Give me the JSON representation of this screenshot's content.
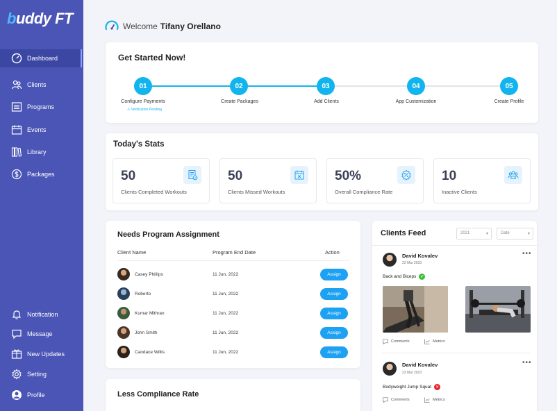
{
  "brand": {
    "logo_first": "b",
    "logo_rest": "uddy FT"
  },
  "nav": {
    "top": [
      {
        "label": "Dashboard",
        "icon": "dashboard-icon"
      },
      {
        "label": "Clients",
        "icon": "clients-icon"
      },
      {
        "label": "Programs",
        "icon": "programs-icon"
      },
      {
        "label": "Events",
        "icon": "events-icon"
      },
      {
        "label": "Library",
        "icon": "library-icon"
      },
      {
        "label": "Packages",
        "icon": "packages-icon"
      }
    ],
    "bottom": [
      {
        "label": "Notification",
        "icon": "bell-icon"
      },
      {
        "label": "Message",
        "icon": "message-icon"
      },
      {
        "label": "New Updates",
        "icon": "updates-icon"
      },
      {
        "label": "Setting",
        "icon": "gear-icon"
      },
      {
        "label": "Profile",
        "icon": "profile-icon"
      }
    ]
  },
  "header": {
    "welcome": "Welcome",
    "user_name": "Tifany Orellano"
  },
  "get_started": {
    "title": "Get Started Now!",
    "steps": [
      {
        "num": "01",
        "label": "Configure Payments",
        "sub": "Verification Pending"
      },
      {
        "num": "02",
        "label": "Create Packages"
      },
      {
        "num": "03",
        "label": "Add Clients"
      },
      {
        "num": "04",
        "label": "App Customization"
      },
      {
        "num": "05",
        "label": "Create Profile"
      }
    ]
  },
  "stats": {
    "title": "Today's Stats",
    "items": [
      {
        "value": "50",
        "label": "Clients Completed Workouts",
        "icon": "workout-check-icon"
      },
      {
        "value": "50",
        "label": "Clients Missed Workouts",
        "icon": "calendar-x-icon"
      },
      {
        "value": "50%",
        "label": "Overall Compliance Rate",
        "icon": "compliance-badge-icon"
      },
      {
        "value": "10",
        "label": "Inactive Clients",
        "icon": "group-icon"
      }
    ]
  },
  "program_assignment": {
    "title": "Needs Program Assignment",
    "columns": [
      "Client Name",
      "Program End Date",
      "Action"
    ],
    "rows": [
      {
        "name": "Casey Phillips",
        "date": "11 Jun, 2022",
        "action": "Assign"
      },
      {
        "name": "Roberto",
        "date": "11 Jun, 2022",
        "action": "Assign"
      },
      {
        "name": "Kumar Mithran",
        "date": "11 Jun, 2022",
        "action": "Assign"
      },
      {
        "name": "John Smith",
        "date": "11 Jun, 2022",
        "action": "Assign"
      },
      {
        "name": "Candace Willis",
        "date": "11 Jun, 2022",
        "action": "Assign"
      }
    ]
  },
  "less_compliance": {
    "title": "Less Compliance Rate"
  },
  "feed": {
    "title": "Clients Feed",
    "year_select": "2021",
    "date_select": "Date",
    "posts": [
      {
        "name": "David Kovalev",
        "date": "23 Mar 2023",
        "title": "Back and Biceps",
        "status": "completed",
        "comments": "Comments",
        "metrics": "Metrics"
      },
      {
        "name": "David Kovalev",
        "date": "23 Mar 2023",
        "title": "Bodyweight Jump Squat",
        "status": "missed",
        "comments": "Comments",
        "metrics": "Metrics"
      }
    ]
  },
  "colors": {
    "sidebar": "#4a55b5",
    "accent": "#12b4ee",
    "button": "#1da1f2",
    "success": "#3cc13b",
    "danger": "#e5252a"
  }
}
